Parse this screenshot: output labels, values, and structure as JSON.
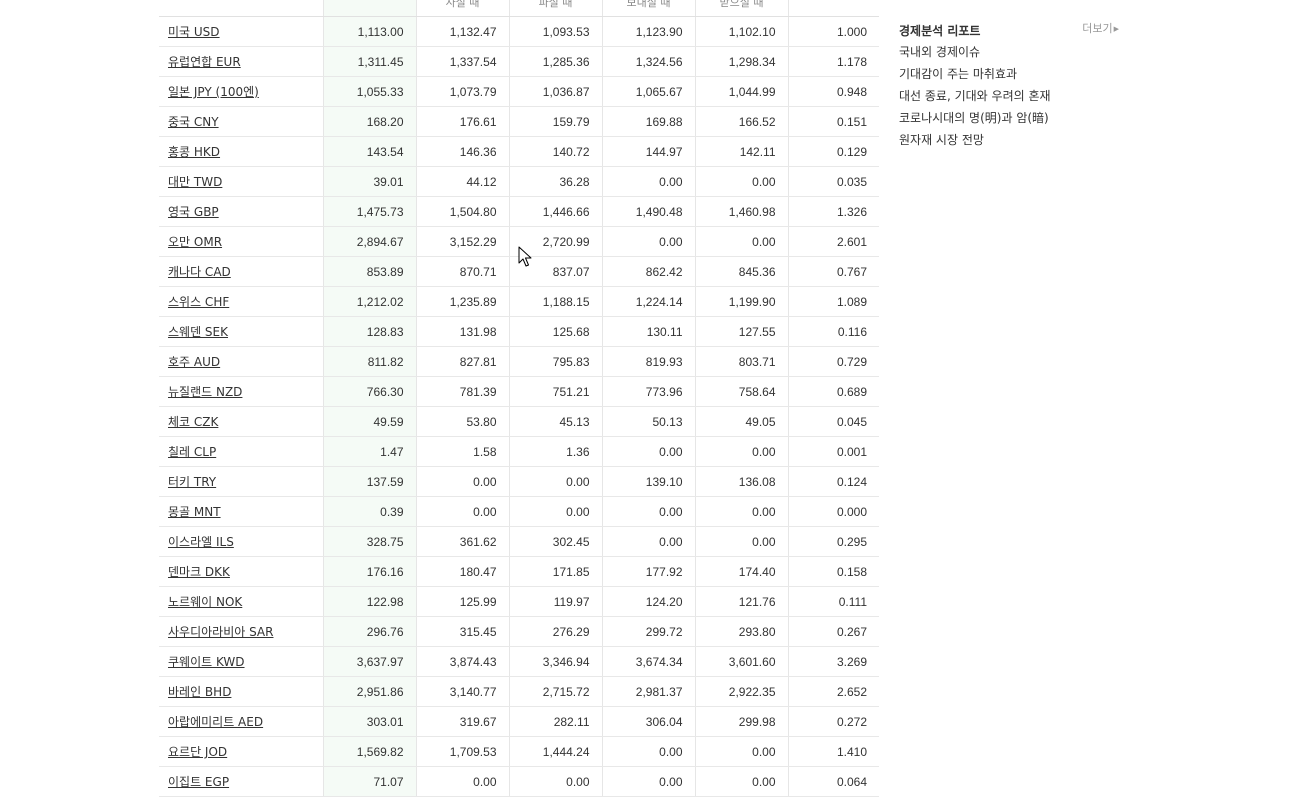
{
  "fx_table": {
    "headers": [
      "",
      "",
      "사실 때",
      "파실 때",
      "보내실 때",
      "받으실 때",
      ""
    ],
    "rows": [
      {
        "currency": "미국 USD",
        "values": [
          "1,113.00",
          "1,132.47",
          "1,093.53",
          "1,123.90",
          "1,102.10",
          "1.000"
        ]
      },
      {
        "currency": "유럽연합 EUR",
        "values": [
          "1,311.45",
          "1,337.54",
          "1,285.36",
          "1,324.56",
          "1,298.34",
          "1.178"
        ]
      },
      {
        "currency": "일본 JPY (100엔)",
        "values": [
          "1,055.33",
          "1,073.79",
          "1,036.87",
          "1,065.67",
          "1,044.99",
          "0.948"
        ]
      },
      {
        "currency": "중국 CNY",
        "values": [
          "168.20",
          "176.61",
          "159.79",
          "169.88",
          "166.52",
          "0.151"
        ]
      },
      {
        "currency": "홍콩 HKD",
        "values": [
          "143.54",
          "146.36",
          "140.72",
          "144.97",
          "142.11",
          "0.129"
        ]
      },
      {
        "currency": "대만 TWD",
        "values": [
          "39.01",
          "44.12",
          "36.28",
          "0.00",
          "0.00",
          "0.035"
        ]
      },
      {
        "currency": "영국 GBP",
        "values": [
          "1,475.73",
          "1,504.80",
          "1,446.66",
          "1,490.48",
          "1,460.98",
          "1.326"
        ]
      },
      {
        "currency": "오만 OMR",
        "values": [
          "2,894.67",
          "3,152.29",
          "2,720.99",
          "0.00",
          "0.00",
          "2.601"
        ]
      },
      {
        "currency": "캐나다 CAD",
        "values": [
          "853.89",
          "870.71",
          "837.07",
          "862.42",
          "845.36",
          "0.767"
        ]
      },
      {
        "currency": "스위스 CHF",
        "values": [
          "1,212.02",
          "1,235.89",
          "1,188.15",
          "1,224.14",
          "1,199.90",
          "1.089"
        ]
      },
      {
        "currency": "스웨덴 SEK",
        "values": [
          "128.83",
          "131.98",
          "125.68",
          "130.11",
          "127.55",
          "0.116"
        ]
      },
      {
        "currency": "호주 AUD",
        "values": [
          "811.82",
          "827.81",
          "795.83",
          "819.93",
          "803.71",
          "0.729"
        ]
      },
      {
        "currency": "뉴질랜드 NZD",
        "values": [
          "766.30",
          "781.39",
          "751.21",
          "773.96",
          "758.64",
          "0.689"
        ]
      },
      {
        "currency": "체코 CZK",
        "values": [
          "49.59",
          "53.80",
          "45.13",
          "50.13",
          "49.05",
          "0.045"
        ]
      },
      {
        "currency": "칠레 CLP",
        "values": [
          "1.47",
          "1.58",
          "1.36",
          "0.00",
          "0.00",
          "0.001"
        ]
      },
      {
        "currency": "터키 TRY",
        "values": [
          "137.59",
          "0.00",
          "0.00",
          "139.10",
          "136.08",
          "0.124"
        ]
      },
      {
        "currency": "몽골 MNT",
        "values": [
          "0.39",
          "0.00",
          "0.00",
          "0.00",
          "0.00",
          "0.000"
        ]
      },
      {
        "currency": "이스라엘 ILS",
        "values": [
          "328.75",
          "361.62",
          "302.45",
          "0.00",
          "0.00",
          "0.295"
        ]
      },
      {
        "currency": "덴마크 DKK",
        "values": [
          "176.16",
          "180.47",
          "171.85",
          "177.92",
          "174.40",
          "0.158"
        ]
      },
      {
        "currency": "노르웨이 NOK",
        "values": [
          "122.98",
          "125.99",
          "119.97",
          "124.20",
          "121.76",
          "0.111"
        ]
      },
      {
        "currency": "사우디아라비아 SAR",
        "values": [
          "296.76",
          "315.45",
          "276.29",
          "299.72",
          "293.80",
          "0.267"
        ]
      },
      {
        "currency": "쿠웨이트 KWD",
        "values": [
          "3,637.97",
          "3,874.43",
          "3,346.94",
          "3,674.34",
          "3,601.60",
          "3.269"
        ]
      },
      {
        "currency": "바레인 BHD",
        "values": [
          "2,951.86",
          "3,140.77",
          "2,715.72",
          "2,981.37",
          "2,922.35",
          "2.652"
        ]
      },
      {
        "currency": "아랍에미리트 AED",
        "values": [
          "303.01",
          "319.67",
          "282.11",
          "306.04",
          "299.98",
          "0.272"
        ]
      },
      {
        "currency": "요르단 JOD",
        "values": [
          "1,569.82",
          "1,709.53",
          "1,444.24",
          "0.00",
          "0.00",
          "1.410"
        ]
      },
      {
        "currency": "이집트 EGP",
        "values": [
          "71.07",
          "0.00",
          "0.00",
          "0.00",
          "0.00",
          "0.064"
        ]
      }
    ]
  },
  "sidebar": {
    "title": "경제분석 리포트",
    "more_label": "더보기",
    "items": [
      "국내외 경제이슈",
      "기대감이 주는 마취효과",
      "대선 종료, 기대와 우려의 혼재",
      "코로나시대의 명(明)과 암(暗)",
      "원자재 시장 전망"
    ]
  },
  "icons": {
    "more_arrow": "chevron-right-icon",
    "cursor": "mouse-pointer-icon"
  },
  "colors": {
    "highlight_column": "#f5fbf6",
    "row_border": "#e8e8e8"
  }
}
